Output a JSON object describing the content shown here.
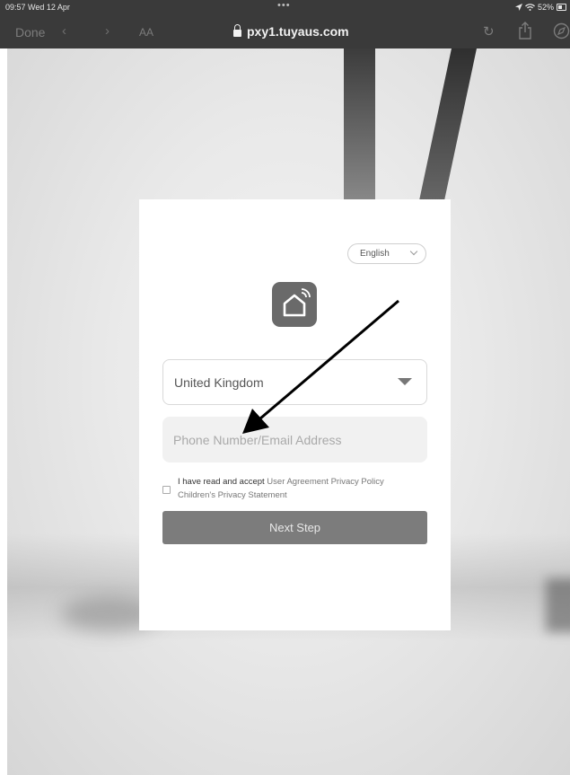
{
  "status_bar": {
    "time": "09:57  Wed 12 Apr",
    "dots": "•••",
    "battery": "52%"
  },
  "browser": {
    "done_label": "Done",
    "back_icon": "chevron-left-icon",
    "forward_icon": "chevron-right-icon",
    "text_size_label": "AA",
    "url": "pxy1.tuyaus.com",
    "reload_icon": "reload-icon",
    "share_icon": "share-icon",
    "compass_icon": "compass-icon"
  },
  "login": {
    "language": "English",
    "country": "United Kingdom",
    "phone_placeholder": "Phone Number/Email Address",
    "agree_prefix": "I have read and accept",
    "user_agreement": "User Agreement",
    "privacy_policy": "Privacy Policy",
    "children_privacy": "Children's Privacy Statement",
    "next_label": "Next Step"
  },
  "colors": {
    "toolbar_bg": "#3a3a3a",
    "button_bg": "#7c7c7c",
    "logo_bg": "#6a6a6a"
  }
}
